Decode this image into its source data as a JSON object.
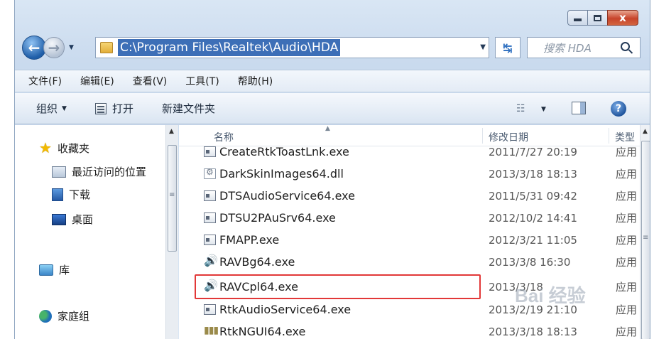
{
  "window": {
    "controls": {
      "minimize": "–",
      "maximize": "□",
      "close": "x"
    }
  },
  "address": {
    "path": "C:\\Program Files\\Realtek\\Audio\\HDA",
    "search_placeholder": "搜索 HDA"
  },
  "menu": [
    {
      "label": "文件(F)"
    },
    {
      "label": "编辑(E)"
    },
    {
      "label": "查看(V)"
    },
    {
      "label": "工具(T)"
    },
    {
      "label": "帮助(H)"
    }
  ],
  "commands": {
    "organize": "组织",
    "open": "打开",
    "new_folder": "新建文件夹"
  },
  "navpane": {
    "favorites": "收藏夹",
    "recent": "最近访问的位置",
    "downloads": "下载",
    "desktop": "桌面",
    "libraries": "库",
    "homegroup": "家庭组"
  },
  "columns": {
    "name": "名称",
    "date": "修改日期",
    "type": "类型"
  },
  "files": [
    {
      "name": "CreateRtkToastLnk.exe",
      "date": "2011/7/27 20:19",
      "type": "应用",
      "icon": "exe-icon"
    },
    {
      "name": "DarkSkinImages64.dll",
      "date": "2013/3/18 18:13",
      "type": "应用",
      "icon": "dll-icon"
    },
    {
      "name": "DTSAudioService64.exe",
      "date": "2011/5/31 09:42",
      "type": "应用",
      "icon": "exe-icon"
    },
    {
      "name": "DTSU2PAuSrv64.exe",
      "date": "2012/10/2 14:41",
      "type": "应用",
      "icon": "exe-icon"
    },
    {
      "name": "FMAPP.exe",
      "date": "2012/3/21 11:05",
      "type": "应用",
      "icon": "exe-icon"
    },
    {
      "name": "RAVBg64.exe",
      "date": "2013/3/8 16:30",
      "type": "应用",
      "icon": "speaker-icon"
    },
    {
      "name": "RAVCpl64.exe",
      "date": "2013/3/18",
      "type": "应用",
      "icon": "speaker-icon"
    },
    {
      "name": "RtkAudioService64.exe",
      "date": "2013/2/19 21:10",
      "type": "应用",
      "icon": "exe-icon"
    },
    {
      "name": "RtkNGUI64.exe",
      "date": "2013/3/18 18:13",
      "type": "应用",
      "icon": "bars-icon"
    }
  ],
  "watermark": {
    "text": "Bai 经验"
  }
}
